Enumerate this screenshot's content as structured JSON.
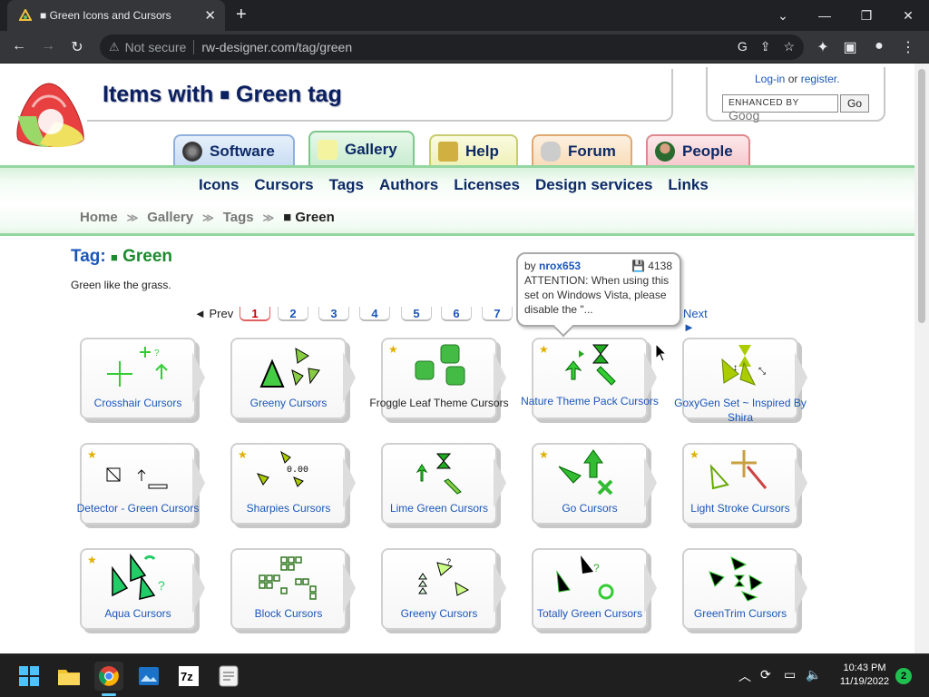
{
  "browser": {
    "tab_title": "■ Green Icons and Cursors",
    "not_secure": "Not secure",
    "url": "rw-designer.com/tag/green"
  },
  "header": {
    "title_prefix": "Items with",
    "title_square": "■",
    "title_suffix": "Green tag",
    "login": "Log-in",
    "or": "or",
    "register": "register.",
    "search_brand": "ENHANCED BY",
    "search_google": "Goog",
    "go": "Go"
  },
  "top_tabs": [
    {
      "label": "Software"
    },
    {
      "label": "Gallery"
    },
    {
      "label": "Help"
    },
    {
      "label": "Forum"
    },
    {
      "label": "People"
    }
  ],
  "main_nav": [
    "Icons",
    "Cursors",
    "Tags",
    "Authors",
    "Licenses",
    "Design services",
    "Links"
  ],
  "breadcrumb": [
    "Home",
    "Gallery",
    "Tags",
    "■ Green"
  ],
  "tag": {
    "label": "Tag:",
    "square": "■",
    "name": "Green",
    "description": "Green like the grass."
  },
  "pager": {
    "prev": "◄ Prev",
    "next": "Next ►",
    "pages": [
      "1",
      "2",
      "3",
      "4",
      "5",
      "6",
      "7"
    ],
    "current": "1"
  },
  "tooltip": {
    "by": "by",
    "author": "nrox653",
    "downloads": "4138",
    "text": "ATTENTION: When using this set on Windows Vista, please disable the \"..."
  },
  "items": [
    {
      "title": "Crosshair Cursors",
      "featured": false
    },
    {
      "title": "Greeny Cursors",
      "featured": false
    },
    {
      "title": "Froggle Leaf Theme Cursors",
      "featured": true
    },
    {
      "title": "Nature Theme Pack Cursors",
      "featured": true
    },
    {
      "title": "GoxyGen Set ~ Inspired By Shira",
      "featured": false
    },
    {
      "title": "Detector - Green Cursors",
      "featured": true
    },
    {
      "title": "Sharpies Cursors",
      "featured": true
    },
    {
      "title": "Lime Green Cursors",
      "featured": false
    },
    {
      "title": "Go Cursors",
      "featured": true
    },
    {
      "title": "Light Stroke Cursors",
      "featured": true
    },
    {
      "title": "Aqua Cursors",
      "featured": true
    },
    {
      "title": "Block Cursors",
      "featured": false
    },
    {
      "title": "Greeny Cursors",
      "featured": false
    },
    {
      "title": "Totally Green Cursors",
      "featured": false
    },
    {
      "title": "GreenTrim Cursors",
      "featured": false
    }
  ],
  "taskbar": {
    "time": "10:43 PM",
    "date": "11/19/2022",
    "notifications": "2"
  }
}
